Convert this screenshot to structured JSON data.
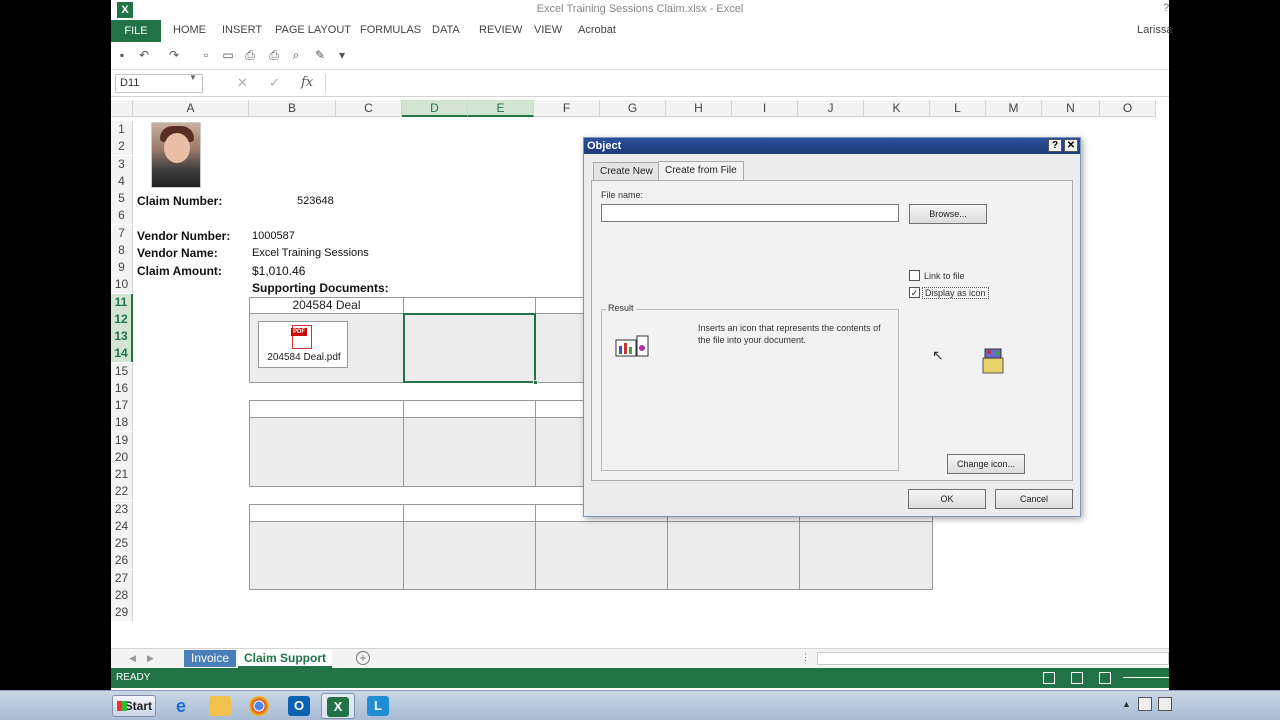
{
  "window": {
    "title": "Excel Training Sessions Claim.xlsx - Excel",
    "help": "?",
    "app_icon": "X"
  },
  "ribbon": {
    "file_tab": "FILE",
    "tabs": [
      "HOME",
      "INSERT",
      "PAGE LAYOUT",
      "FORMULAS",
      "DATA",
      "REVIEW",
      "VIEW",
      "Acrobat"
    ],
    "user": "Larissa"
  },
  "formula_bar": {
    "name_box": "D11",
    "fx": "fx",
    "cancel": "✕",
    "enter": "✓",
    "formula": ""
  },
  "columns": [
    "A",
    "B",
    "C",
    "D",
    "E",
    "F",
    "G",
    "H",
    "I",
    "J",
    "K",
    "L",
    "M",
    "N",
    "O"
  ],
  "selected_columns": [
    "D",
    "E"
  ],
  "rows": [
    "1",
    "2",
    "3",
    "4",
    "5",
    "6",
    "7",
    "8",
    "9",
    "10",
    "11",
    "12",
    "13",
    "14",
    "15",
    "16",
    "17",
    "18",
    "19",
    "20",
    "21",
    "22",
    "23",
    "24",
    "25",
    "26",
    "27",
    "28",
    "29"
  ],
  "selected_rows": [
    "11",
    "12",
    "13",
    "14"
  ],
  "sheet": {
    "claim_number_label": "Claim Number:",
    "claim_number": "523648",
    "vendor_number_label": "Vendor Number:",
    "vendor_number": "1000587",
    "vendor_name_label": "Vendor Name:",
    "vendor_name": "Excel Training Sessions",
    "claim_amount_label": "Claim Amount:",
    "claim_amount": "$1,010.46",
    "supporting_label": "Supporting Documents:",
    "doc_header": "204584 Deal",
    "pdf_badge": "PDF",
    "pdf_filename": "204584 Deal.pdf"
  },
  "sheet_tabs": {
    "tab1": "Invoice",
    "tab2": "Claim Support",
    "add": "+"
  },
  "status": {
    "text": "READY"
  },
  "taskbar": {
    "start": "Start"
  },
  "dialog": {
    "title": "Object",
    "help_btn": "?",
    "close_btn": "✕",
    "tab_create_new": "Create New",
    "tab_create_from_file": "Create from File",
    "file_name_label": "File name:",
    "file_name_value": "",
    "browse": "Browse...",
    "link_to_file": "Link to file",
    "link_checked": "",
    "display_as_icon": "Display as icon",
    "display_checked": "✓",
    "result_legend": "Result",
    "result_text": "Inserts an icon that represents the contents of the file into your document.",
    "change_icon": "Change icon...",
    "ok": "OK",
    "cancel": "Cancel"
  }
}
